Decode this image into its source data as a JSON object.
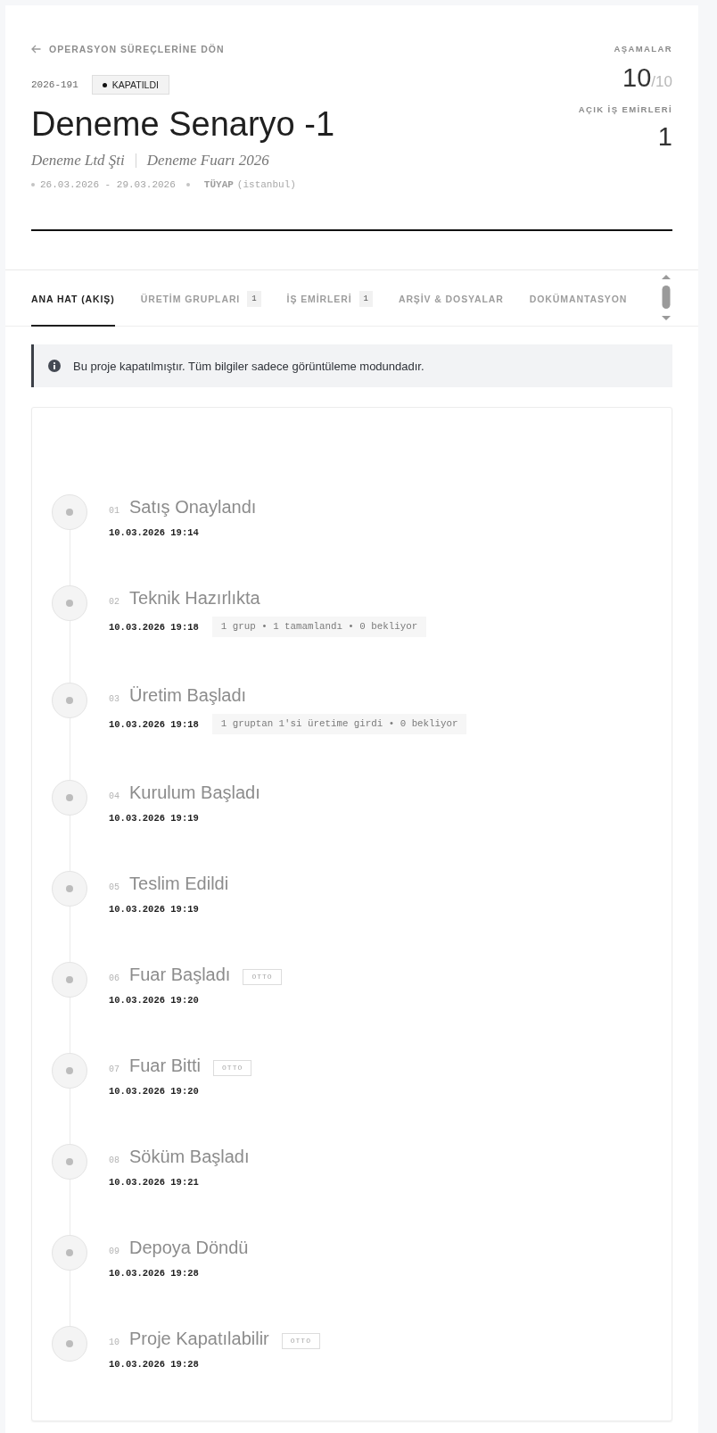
{
  "back_link": {
    "label": "OPERASYON SÜREÇLERİNE DÖN"
  },
  "project": {
    "code": "2026-191",
    "status": "KAPATILDI",
    "title": "Deneme Senaryo -1",
    "customer": "Deneme Ltd Şti",
    "event": "Deneme Fuarı 2026",
    "dates": "26.03.2026 - 29.03.2026",
    "venue": "TÜYAP",
    "city": "(istanbul)"
  },
  "stats": [
    {
      "label": "AŞAMALAR",
      "value": "10",
      "total": "/10"
    },
    {
      "label": "AÇIK İŞ EMİRLERİ",
      "value": "1"
    }
  ],
  "tabs": [
    {
      "label": "ANA HAT (AKIŞ)",
      "selected": true
    },
    {
      "label": "ÜRETİM GRUPLARI",
      "count": "1",
      "selected": false
    },
    {
      "label": "İŞ EMİRLERİ",
      "count": "1",
      "selected": false
    },
    {
      "label": "ARŞİV & DOSYALAR",
      "selected": false
    },
    {
      "label": "DOKÜMANTASYON",
      "selected": false
    }
  ],
  "notice": {
    "text": "Bu proje kapatılmıştır. Tüm bilgiler sadece görüntüleme modundadır."
  },
  "timeline": [
    {
      "number": "01",
      "title": "Satış Onaylandı",
      "timestamp": "10.03.2026 19:14"
    },
    {
      "number": "02",
      "title": "Teknik Hazırlıkta",
      "timestamp": "10.03.2026 19:18",
      "summary": "1 grup • 1 tamamlandı • 0 bekliyor"
    },
    {
      "number": "03",
      "title": "Üretim Başladı",
      "timestamp": "10.03.2026 19:18",
      "summary": "1 gruptan 1'si üretime girdi • 0 bekliyor"
    },
    {
      "number": "04",
      "title": "Kurulum Başladı",
      "timestamp": "10.03.2026 19:19"
    },
    {
      "number": "05",
      "title": "Teslim Edildi",
      "timestamp": "10.03.2026 19:19"
    },
    {
      "number": "06",
      "title": "Fuar Başladı",
      "badge": "OTTO",
      "timestamp": "10.03.2026 19:20"
    },
    {
      "number": "07",
      "title": "Fuar Bitti",
      "badge": "OTTO",
      "timestamp": "10.03.2026 19:20"
    },
    {
      "number": "08",
      "title": "Söküm Başladı",
      "timestamp": "10.03.2026 19:21"
    },
    {
      "number": "09",
      "title": "Depoya Döndü",
      "timestamp": "10.03.2026 19:28"
    },
    {
      "number": "10",
      "title": "Proje Kapatılabilir",
      "badge": "OTTO",
      "timestamp": "10.03.2026 19:28"
    }
  ]
}
